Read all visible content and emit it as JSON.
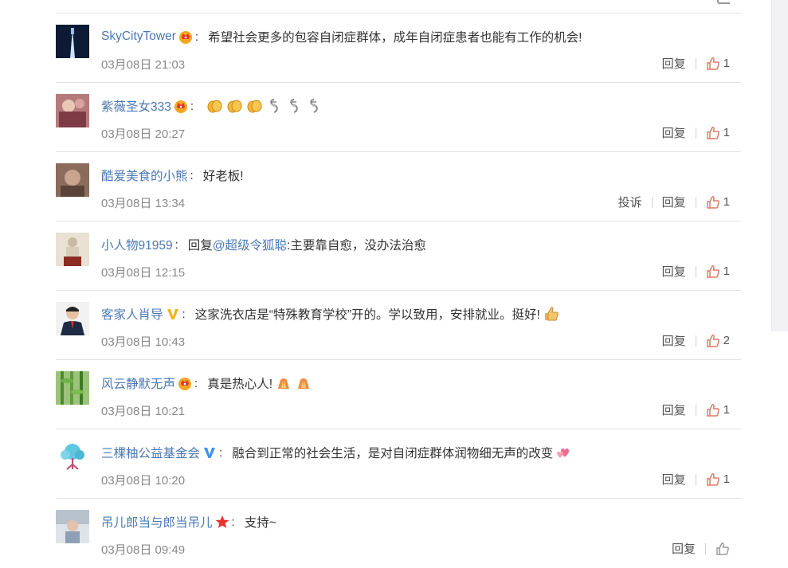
{
  "colors": {
    "username": "#4a78b4",
    "time": "#888888",
    "like_icon": "#e07a66",
    "like_icon_gray": "#999999",
    "divider": "#e2e2e2"
  },
  "comments": [
    {
      "user": "SkyCityTower",
      "badge": "crown-badge-icon",
      "content": "希望社会更多的包容自闭症群体，成年自闭症患者也能有工作的机会!",
      "emojis": [],
      "time": "03月08日 21:03",
      "report": "",
      "reply": "回复",
      "likes": "1"
    },
    {
      "user": "紫薇圣女333",
      "badge": "crown-badge-icon",
      "content": "",
      "emojis": [
        "clap-icon",
        "clap-icon",
        "clap-icon",
        "ribbon-icon",
        "ribbon-icon",
        "ribbon-icon"
      ],
      "time": "03月08日 20:27",
      "report": "",
      "reply": "回复",
      "likes": "1"
    },
    {
      "user": "酷爱美食的小熊",
      "badge": "",
      "content": "好老板!",
      "emojis": [],
      "time": "03月08日 13:34",
      "report": "投诉",
      "reply": "回复",
      "likes": "1"
    },
    {
      "user": "小人物91959",
      "badge": "",
      "content_prefix": "回复",
      "mention": "@超级令狐聪",
      "content": ":主要靠自愈，没办法治愈",
      "emojis": [],
      "time": "03月08日 12:15",
      "report": "",
      "reply": "回复",
      "likes": "1"
    },
    {
      "user": "客家人肖导",
      "badge": "verified-v-gold-icon",
      "content": "这家洗衣店是“特殊教育学校”开的。学以致用，安排就业。挺好!",
      "emojis": [
        "thumbs-up-emoji-icon"
      ],
      "time": "03月08日 10:43",
      "report": "",
      "reply": "回复",
      "likes": "2"
    },
    {
      "user": "风云静默无声",
      "badge": "crown-badge-icon",
      "content": "真是热心人!",
      "emojis": [
        "praying-hands-icon",
        "praying-hands-icon"
      ],
      "time": "03月08日 10:21",
      "report": "",
      "reply": "回复",
      "likes": "1"
    },
    {
      "user": "三棵柚公益基金会",
      "badge": "verified-v-blue-icon",
      "content": "融合到正常的社会生活，是对自闭症群体润物细无声的改变",
      "emojis": [
        "hearts-icon"
      ],
      "time": "03月08日 10:20",
      "report": "",
      "reply": "回复",
      "likes": "1"
    },
    {
      "user": "吊儿郎当与郎当吊儿",
      "badge": "red-star-icon",
      "content": "支持~",
      "emojis": [],
      "time": "03月08日 09:49",
      "report": "",
      "reply": "回复",
      "likes": ""
    }
  ]
}
